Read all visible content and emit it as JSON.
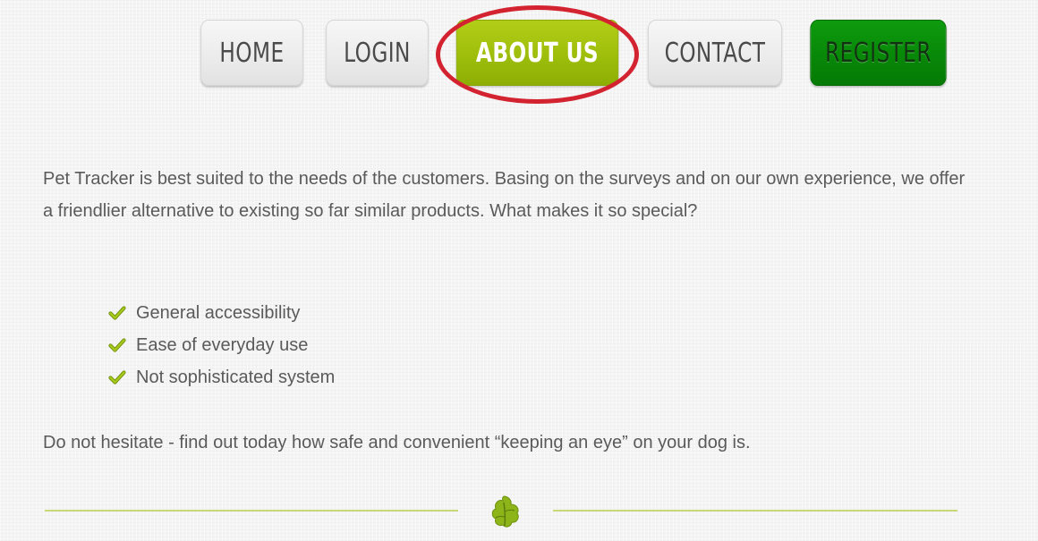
{
  "nav": {
    "items": [
      {
        "label": "HOME"
      },
      {
        "label": "LOGIN"
      },
      {
        "label": "ABOUT US"
      },
      {
        "label": "CONTACT"
      },
      {
        "label": "REGISTER"
      }
    ],
    "active": "ABOUT US"
  },
  "content": {
    "intro": "Pet Tracker is best suited to the needs of the customers. Basing on the surveys and on our own experience, we offer a friendlier alternative to existing so far similar products. What makes it so special?",
    "features": [
      "General accessibility",
      "Ease of everyday use",
      "Not sophisticated system"
    ],
    "closing": "Do not hesitate - find out today how safe and convenient “keeping an eye” on your dog is."
  },
  "colors": {
    "active": "#9ebe0b",
    "register": "#088808",
    "highlight": "#d42330",
    "check": "#8cb20e",
    "divider": "#c9d97a"
  },
  "icons": {
    "feature_bullet": "check-icon",
    "divider": "leaf-icon"
  }
}
